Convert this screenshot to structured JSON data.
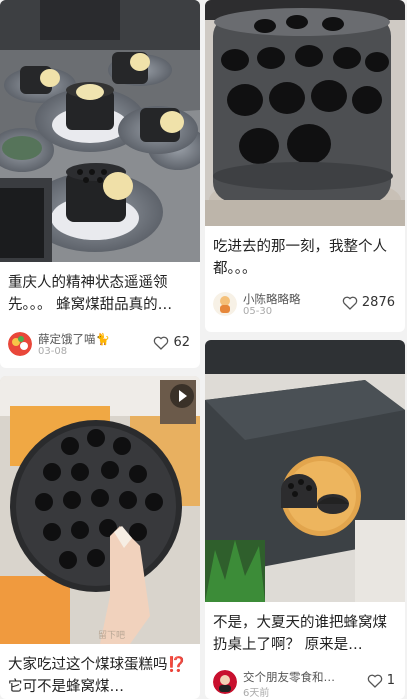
{
  "feed": {
    "cards": [
      {
        "title": "重庆人的精神状态遥遥领先。。。 蜂窝煤甜品真的…",
        "author": "薛定饿了喵🐈",
        "date": "03-08",
        "likes": "62"
      },
      {
        "title": "大家吃过这个煤球蛋糕吗⁉️ 它可不是蜂窝煤…",
        "author": "",
        "date": "",
        "likes": ""
      },
      {
        "title": "吃进去的那一刻，我整个人都。。。",
        "author": "小陈略略略",
        "date": "05-30",
        "likes": "2876"
      },
      {
        "title": "不是，大夏天的谁把蜂窝煤扔桌上了啊？ 原来是…",
        "author": "交个朋友零食和…",
        "date": "6天前",
        "likes": "1"
      }
    ]
  },
  "watermark": "留下吧",
  "icons": {
    "heart": "heart-outline-icon",
    "play": "play-icon"
  },
  "colors": {
    "background": "#f2f2f2",
    "card": "#ffffff",
    "text": "#222222",
    "muted": "#aaaaaa"
  }
}
